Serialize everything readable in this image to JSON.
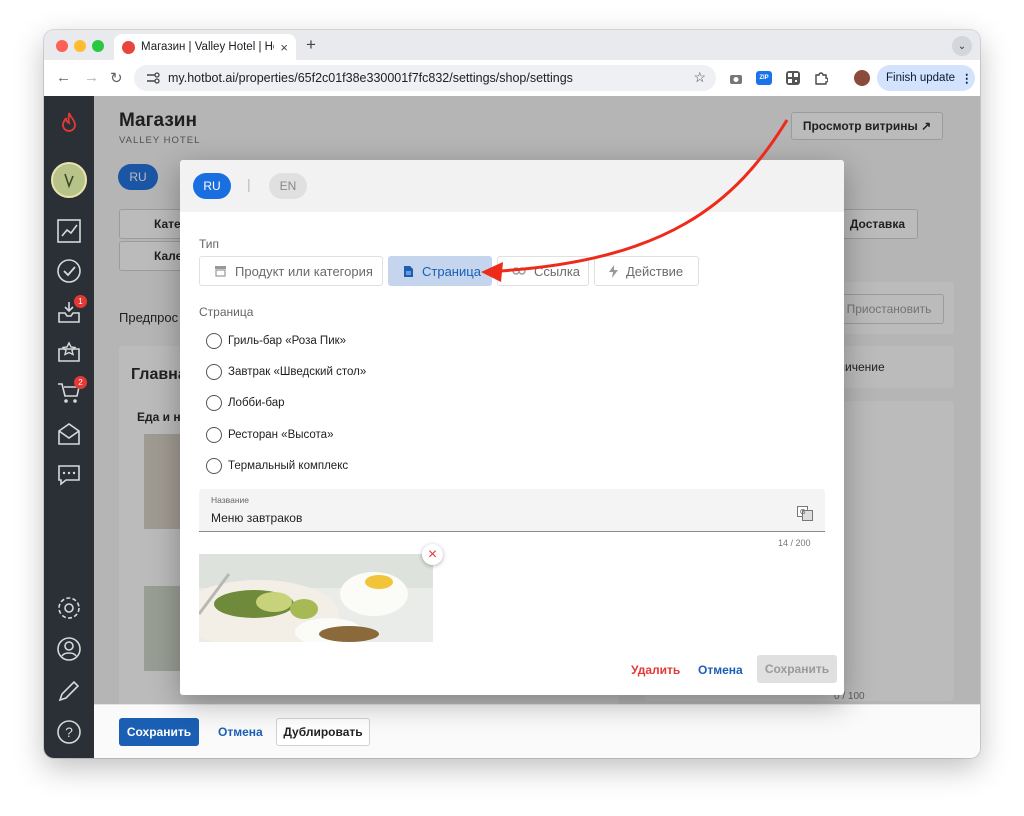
{
  "browser": {
    "tab_title": "Магазин | Valley Hotel | Hotbot",
    "tab_close": "×",
    "new_tab": "+",
    "tab_menu": "⌄",
    "url": "my.hotbot.ai/properties/65f2c01f38e330001f7fc832/settings/shop/settings",
    "finish_update": "Finish update",
    "more": "⋮",
    "back": "←",
    "forward": "→",
    "reload": "↻",
    "star": "☆",
    "zip_label": "ZIP"
  },
  "page": {
    "title": "Магазин",
    "subtitle": "VALLEY HOTEL",
    "view_storefront": "Просмотр витрины ↗",
    "lang_ru": "RU",
    "categories_btn": "Кате",
    "calendar_btn": "Кален",
    "delivery_btn": "Доставка",
    "preview_label": "Предпрос",
    "pause_btn": "Приостановить",
    "main_label": "Главна",
    "restriction": "ограничение",
    "food_label": "Еда и н",
    "counter_bottom": "0 / 100",
    "save": "Сохранить",
    "cancel": "Отмена",
    "duplicate": "Дублировать"
  },
  "sidebar": {
    "badges": [
      "1",
      "2"
    ],
    "icons": [
      "flame-logo-icon",
      "avatar",
      "analytics-icon",
      "check-icon",
      "inbox-icon",
      "star-shield-icon",
      "cart-icon",
      "mail-icon",
      "chat-icon",
      "settings-icon",
      "user-icon",
      "pencil-icon",
      "help-icon"
    ]
  },
  "modal": {
    "lang_ru": "RU",
    "lang_en": "EN",
    "lang_divider": "|",
    "type_label": "Тип",
    "types": [
      {
        "label": "Продукт или категория",
        "icon": "storefront-icon",
        "active": false
      },
      {
        "label": "Страница",
        "icon": "document-icon",
        "active": true
      },
      {
        "label": "Ссылка",
        "icon": "link-icon",
        "active": false
      },
      {
        "label": "Действие",
        "icon": "bolt-icon",
        "active": false
      }
    ],
    "page_label": "Страница",
    "pages": [
      "Гриль-бар «Роза Пик»",
      "Завтрак «Шведский стол»",
      "Лобби-бар",
      "Ресторан «Высота»",
      "Термальный комплекс"
    ],
    "name_label": "Название",
    "name_value": "Меню завтраков",
    "name_counter": "14 / 200",
    "remove_image": "×",
    "delete": "Удалить",
    "cancel": "Отмена",
    "save": "Сохранить"
  },
  "colors": {
    "accent": "#1a6fe0",
    "save_blue": "#1a5fb4",
    "delete_red": "#e53935",
    "arrow_red": "#ee2a1a",
    "sidebar": "#2b3036"
  }
}
